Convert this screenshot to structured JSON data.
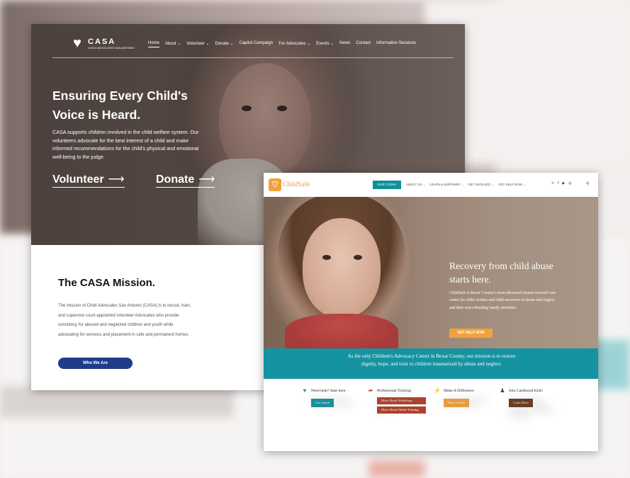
{
  "casa": {
    "logo": {
      "name": "CASA",
      "tagline": "CHILD ADVOCATES SAN ANTONIO",
      "icon": "casa-heart-figure-icon"
    },
    "nav": [
      {
        "label": "Home",
        "active": true
      },
      {
        "label": "About ⌄"
      },
      {
        "label": "Volunteer ⌄"
      },
      {
        "label": "Donate ⌄"
      },
      {
        "label": "Capitol Campaign"
      },
      {
        "label": "For Advocates ⌄"
      },
      {
        "label": "Events ⌄"
      },
      {
        "label": "News"
      },
      {
        "label": "Contact"
      },
      {
        "label": "Information Sessions"
      }
    ],
    "hero": {
      "headline": "Ensuring Every Child's Voice is Heard.",
      "body": "CASA supports children involved in the child welfare system. Our volunteers advocate for the best interest of a child and make informed recommendations for the child's physical and emotional well-being to the judge.",
      "cta_volunteer": "Volunteer",
      "cta_donate": "Donate",
      "arrow": "⟶"
    },
    "mission": {
      "title": "The CASA Mission.",
      "body": "The mission of Child Advocates San Antonio (CASA) is to recruit, train, and supervise court-appointed volunteer Advocates who provide constancy for abused and neglected children and youth while advocating for services and placement in safe and permanent homes.",
      "button": "Who We Are"
    },
    "colors": {
      "button": "#1f3b8b"
    }
  },
  "childsafe": {
    "logo": {
      "name": "ChildSafe",
      "icon": "childsafe-logo-icon"
    },
    "give_button": "GIVE TODAY",
    "nav": [
      "ABOUT US ⌄",
      "LEARN & EMPOWER ⌄",
      "GET INVOLVED ⌄",
      "GET HELP NOW ⌄"
    ],
    "social": [
      "twitter-icon",
      "facebook-icon",
      "youtube-icon",
      "instagram-icon"
    ],
    "social_glyphs": [
      "𝕏",
      "f",
      "▶",
      "◎"
    ],
    "search_glyph": "⚲",
    "hero": {
      "headline": "Recovery from child abuse starts here.",
      "body": "ChildSafe is Bexar County's most advanced trauma-focused care center for child victims and child survivors of abuse and neglect and their non-offending family members.",
      "button": "GET HELP NOW",
      "chevron": "⌄"
    },
    "band": "As the only Children's Advocacy Center in Bexar County, our mission is to restore dignity, hope, and trust to children traumatized by abuse and neglect.",
    "columns": [
      {
        "icon": "heart-icon",
        "glyph": "♥",
        "title": "Need help? Start here.",
        "body": "What to expect, services we provide, and how to get started.",
        "buttons": [
          "Get started"
        ],
        "color": "#1693a0"
      },
      {
        "icon": "share-arrow-icon",
        "glyph": "➦",
        "title": "Professional Training",
        "body": "ChildSafe provides online and in-person child abuse awareness training.",
        "buttons": [
          "More About Workshops",
          "More About Online Training"
        ],
        "color": "#b0412c"
      },
      {
        "icon": "lightning-icon",
        "glyph": "⚡",
        "title": "Make A Difference",
        "body": "Donate, volunteer and learn more about this important work.",
        "buttons": [
          "Ways to help"
        ],
        "color": "#f2a23a"
      },
      {
        "icon": "cardboard-kid-icon",
        "glyph": "♟",
        "title": "Join Cardboard Kids!",
        "body": "Join ChildSafe's yearly Cardboard Kids Campaign to bring awareness to child abuse in our community.",
        "buttons": [
          "Learn More"
        ],
        "color": "#6b3a1e"
      }
    ],
    "colors": {
      "teal": "#1693a0",
      "orange": "#f2a23a"
    }
  }
}
